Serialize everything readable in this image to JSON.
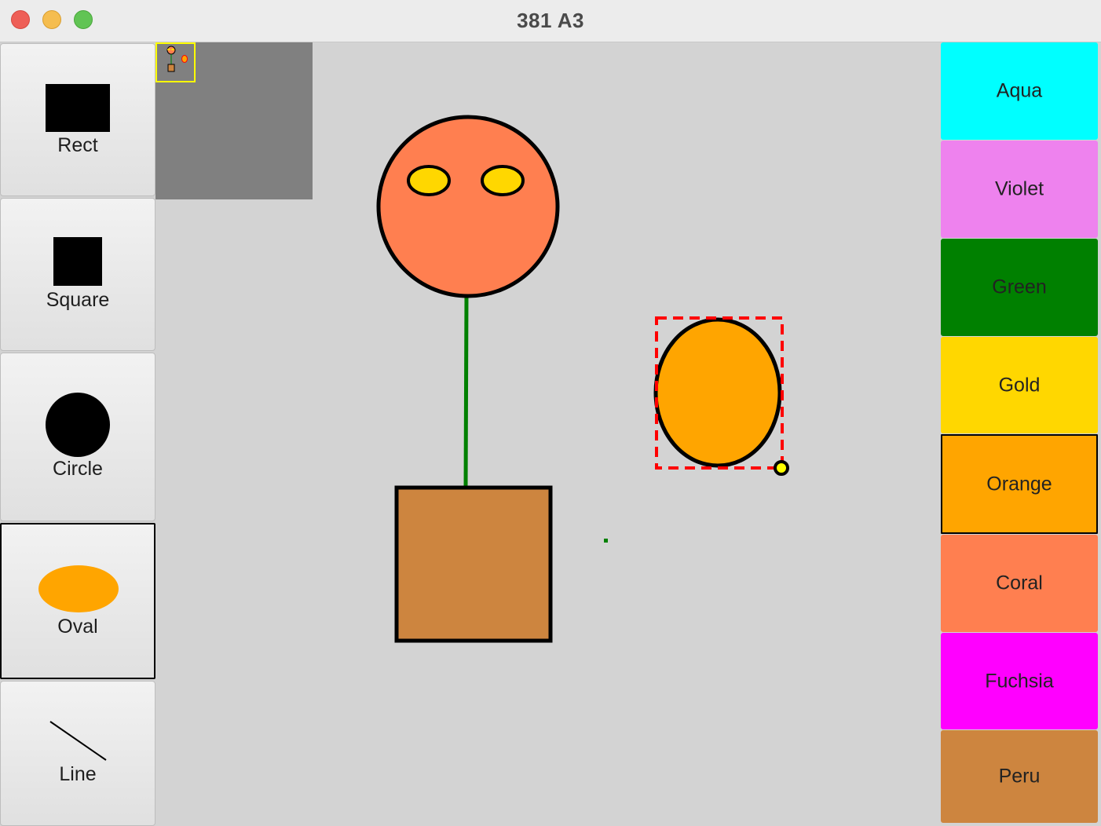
{
  "window": {
    "title": "381 A3",
    "controls": [
      "close",
      "minimize",
      "maximize"
    ]
  },
  "tools": [
    {
      "label": "Rect",
      "icon": "rect-icon",
      "icon_color": "#000000",
      "selected": false
    },
    {
      "label": "Square",
      "icon": "square-icon",
      "icon_color": "#000000",
      "selected": false
    },
    {
      "label": "Circle",
      "icon": "circle-icon",
      "icon_color": "#000000",
      "selected": false
    },
    {
      "label": "Oval",
      "icon": "oval-icon",
      "icon_color": "#ffa500",
      "selected": true
    },
    {
      "label": "Line",
      "icon": "line-icon",
      "icon_color": "#000000",
      "selected": false
    }
  ],
  "colors": [
    {
      "label": "Aqua",
      "hex": "#00ffff",
      "selected": false
    },
    {
      "label": "Violet",
      "hex": "#ee82ee",
      "selected": false
    },
    {
      "label": "Green",
      "hex": "#008000",
      "selected": false
    },
    {
      "label": "Gold",
      "hex": "#ffd700",
      "selected": false
    },
    {
      "label": "Orange",
      "hex": "#ffa500",
      "selected": true
    },
    {
      "label": "Coral",
      "hex": "#ff7f50",
      "selected": false
    },
    {
      "label": "Fuchsia",
      "hex": "#ff00ff",
      "selected": false
    },
    {
      "label": "Peru",
      "hex": "#cd853f",
      "selected": false
    }
  ],
  "canvas": {
    "background": "#d3d3d3",
    "minimap_background": "#808080",
    "minimap_viewport_color": "#ffff00",
    "selection_color": "#ff0000",
    "handle_color": "#ffff00"
  }
}
